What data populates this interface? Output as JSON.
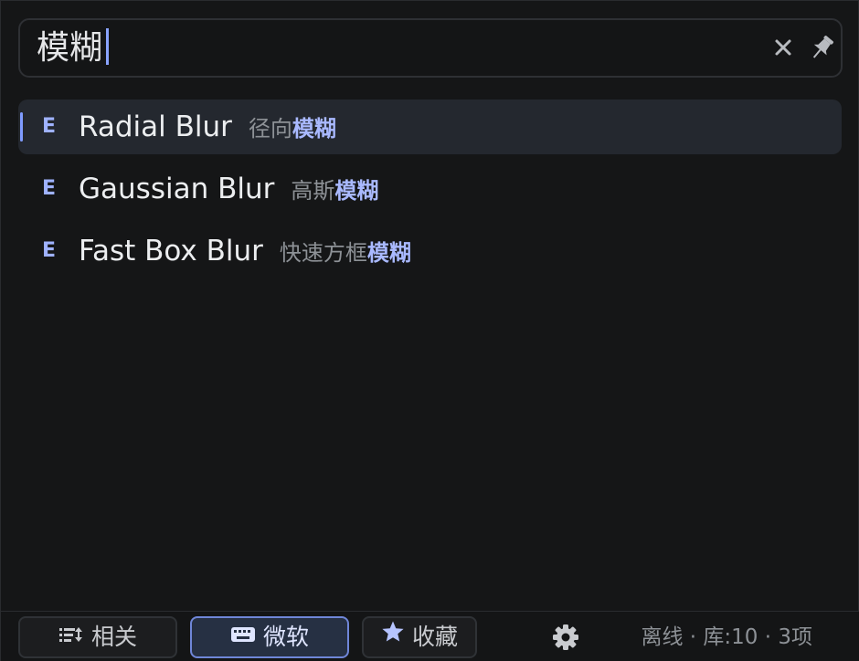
{
  "search": {
    "query": "模糊",
    "clear_icon": "close-icon",
    "pin_icon": "pin-icon"
  },
  "results": [
    {
      "type": "E",
      "name": "Radial Blur",
      "cn_prefix": "径向",
      "cn_highlight": "模糊",
      "selected": true
    },
    {
      "type": "E",
      "name": "Gaussian Blur",
      "cn_prefix": "高斯",
      "cn_highlight": "模糊",
      "selected": false
    },
    {
      "type": "E",
      "name": "Fast Box Blur",
      "cn_prefix": "快速方框",
      "cn_highlight": "模糊",
      "selected": false
    }
  ],
  "footer": {
    "related_label": "相关",
    "microsoft_label": "微软",
    "favorites_label": "收藏",
    "status": "离线 · 库:10 · 3项",
    "active_filter": "microsoft"
  },
  "colors": {
    "accent": "#7f9bff",
    "highlight": "#a9b9ff",
    "background": "#151617",
    "selected_row": "#24282f"
  }
}
